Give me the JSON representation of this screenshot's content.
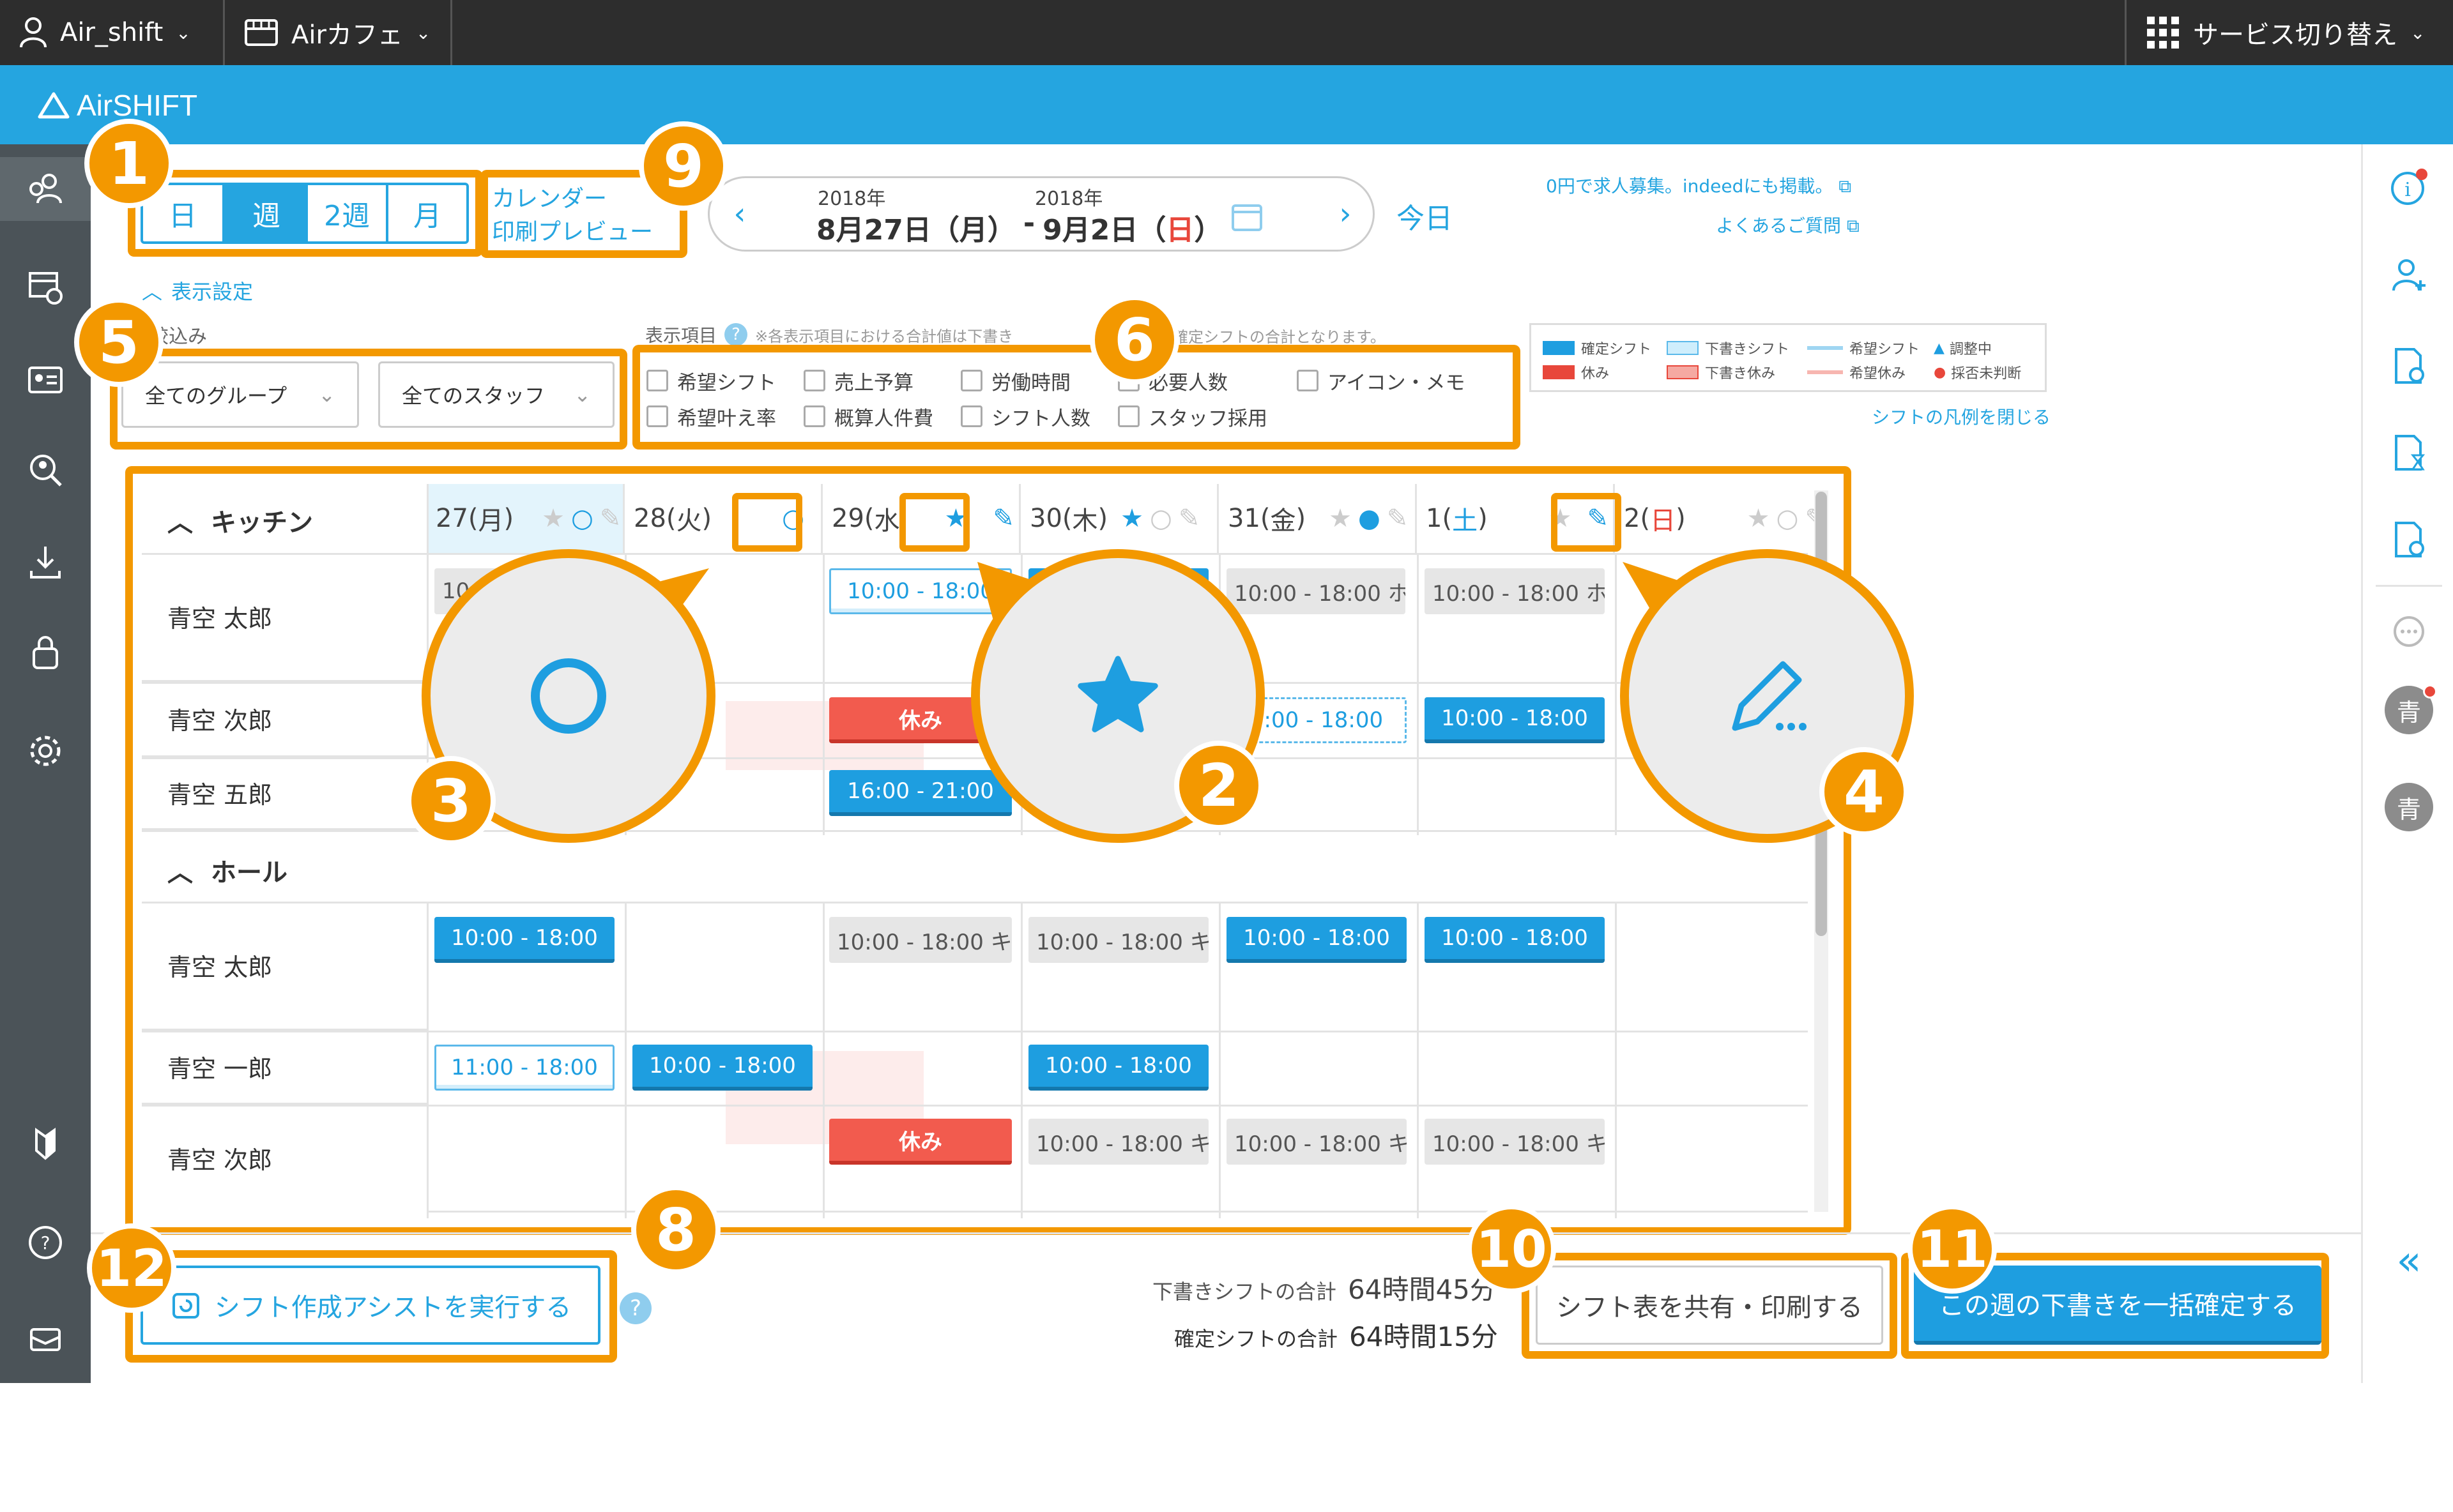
{
  "topbar": {
    "account": "Air_shift",
    "store": "Airカフェ",
    "service_switch": "サービス切り替え"
  },
  "brand": "AirSHIFT",
  "view_tabs": [
    "日",
    "週",
    "2週",
    "月"
  ],
  "calendar_print": {
    "line1": "カレンダー",
    "line2": "印刷プレビュー"
  },
  "date_range": {
    "start_year": "2018年",
    "start": "8月27日（月）",
    "sep": "-",
    "end_year": "2018年",
    "end_pre": "9月2日（",
    "end_day": "日",
    "end_post": "）"
  },
  "today_label": "今日",
  "links": {
    "indeed": "0円で求人募集。indeedにも掲載。",
    "faq": "よくあるご質問"
  },
  "display_settings": "表示設定",
  "filter": {
    "label": "絞込み",
    "group": "全てのグループ",
    "staff": "全てのスタッフ"
  },
  "display_items": {
    "label": "表示項目",
    "note": "※各表示項目における合計値は下書き",
    "note2": "確定シフトの合計となります。",
    "items": [
      "希望シフト",
      "売上予算",
      "労働時間",
      "必要人数",
      "アイコン・メモ",
      "希望叶え率",
      "概算人件費",
      "シフト人数",
      "スタッフ採用"
    ]
  },
  "legend": {
    "fixed": "確定シフト",
    "rest": "休み",
    "draft": "下書きシフト",
    "draft_rest": "下書き休み",
    "wish": "希望シフト",
    "wish_rest": "希望休み",
    "adjusting": "調整中",
    "undecided": "採否未判断",
    "close": "シフトの凡例を閉じる",
    "colors": {
      "fixed": "#1e9ee0",
      "rest": "#e8473b",
      "draft": "#cfeefc",
      "draft_rest": "#f5a9a2",
      "wish": "#9fd6f2",
      "wish_rest": "#f7b6b0"
    }
  },
  "groups": [
    {
      "name": "キッチン"
    },
    {
      "name": "ホール"
    }
  ],
  "days": [
    {
      "num": "27",
      "wd": "月",
      "wd_color": "#444444"
    },
    {
      "num": "28",
      "wd": "火",
      "wd_color": "#444444"
    },
    {
      "num": "29",
      "wd": "水",
      "wd_color": "#444444"
    },
    {
      "num": "30",
      "wd": "木",
      "wd_color": "#444444"
    },
    {
      "num": "31",
      "wd": "金",
      "wd_color": "#444444"
    },
    {
      "num": "1",
      "wd": "土",
      "wd_color": "#1e9ee0"
    },
    {
      "num": "2",
      "wd": "日",
      "wd_color": "#e8473b"
    }
  ],
  "kitchen_rows": [
    {
      "name": "青空 太郎"
    },
    {
      "name": "青空 次郎"
    },
    {
      "name": "青空 五郎"
    }
  ],
  "hall_rows": [
    {
      "name": "青空 太郎"
    },
    {
      "name": "青空 一郎"
    },
    {
      "name": "青空 次郎"
    }
  ],
  "shifts": {
    "k1_d0": "10",
    "k1_d2": "10:00 - 18:00",
    "k1_d4": "10:00 - 18:00 ホ...",
    "k1_d5": "10:00 - 18:00 ホ...",
    "k2_d2": "休み",
    "k2_d4": "0:00 - 18:00",
    "k2_d5": "10:00 - 18:00",
    "k3_d2": "16:00 - 21:00",
    "h1_d0": "10:00 - 18:00",
    "h1_d2": "10:00 - 18:00 キ...",
    "h1_d3": "10:00 - 18:00 キ...",
    "h1_d4": "10:00 - 18:00",
    "h1_d5": "10:00 - 18:00",
    "h2_d0": "11:00 - 18:00",
    "h2_d1": "10:00 - 18:00",
    "h2_d3": "10:00 - 18:00",
    "h3_d2": "休み",
    "h3_d3": "10:00 - 18:00 キ...",
    "h3_d4": "10:00 - 18:00 キ...",
    "h3_d5": "10:00 - 18:00 キ..."
  },
  "totals": {
    "draft_label": "下書きシフトの合計",
    "draft_value": "64時間45分",
    "fixed_label": "確定シフトの合計",
    "fixed_value": "64時間15分"
  },
  "assist_button": "シフト作成アシストを実行する",
  "share_button": "シフト表を共有・印刷する",
  "confirm_button": "この週の下書きを一括確定する",
  "help_mark": "?",
  "avatars": [
    "青",
    "青"
  ],
  "collapse": "«",
  "callouts": [
    "1",
    "2",
    "3",
    "4",
    "5",
    "6",
    "8",
    "9",
    "10",
    "11",
    "12"
  ],
  "accent_color": "#f39800",
  "brand_color": "#25a5e0"
}
